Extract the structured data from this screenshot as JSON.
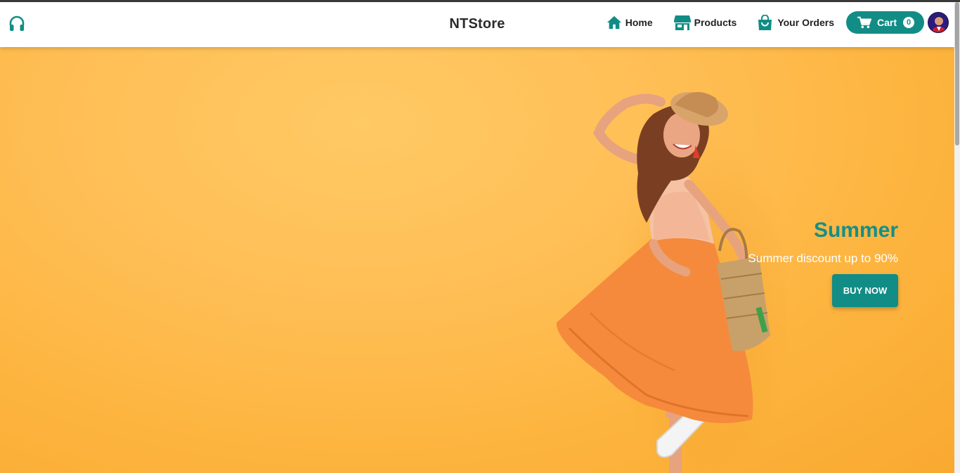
{
  "header": {
    "brand": "NTStore",
    "support_icon": "headset-icon",
    "nav": [
      {
        "label": "Home",
        "icon": "home-icon"
      },
      {
        "label": "Products",
        "icon": "store-icon"
      },
      {
        "label": "Your Orders",
        "icon": "shopping-bag-icon"
      }
    ],
    "cart": {
      "label": "Cart",
      "count": "0",
      "icon": "cart-icon"
    },
    "avatar": "user-avatar"
  },
  "hero": {
    "title": "Summer",
    "subtitle": "Summer discount up to 90%",
    "button_label": "BUY NOW",
    "image": "woman-in-orange-skirt-photo"
  },
  "colors": {
    "accent": "#118d86",
    "hero_background": "#fdb540",
    "text_dark": "#222222"
  }
}
